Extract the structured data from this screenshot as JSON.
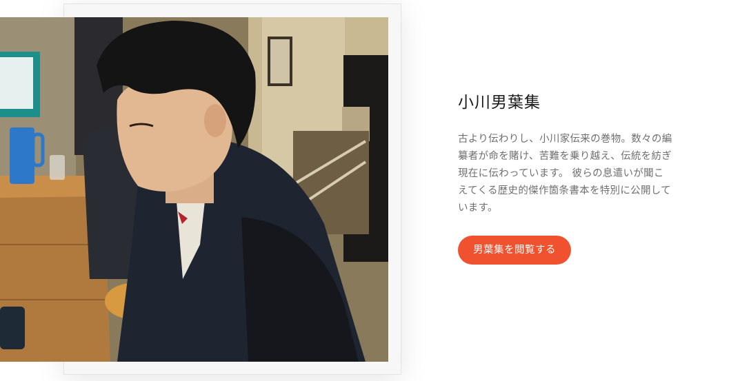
{
  "section": {
    "title": "小川男葉集",
    "description": "古より伝わりし、小川家伝来の巻物。数々の編纂者が命を賭け、苦難を乗り越え、伝統を紡ぎ現在に伝わっています。 彼らの息遣いが聞こえてくる歴史的傑作箇条書本を特別に公開しています。",
    "cta_label": "男葉集を閲覧する"
  },
  "colors": {
    "accent": "#f0512f",
    "title": "#1a1a1a",
    "body_text": "#6f6f6f",
    "background": "#ffffff"
  }
}
